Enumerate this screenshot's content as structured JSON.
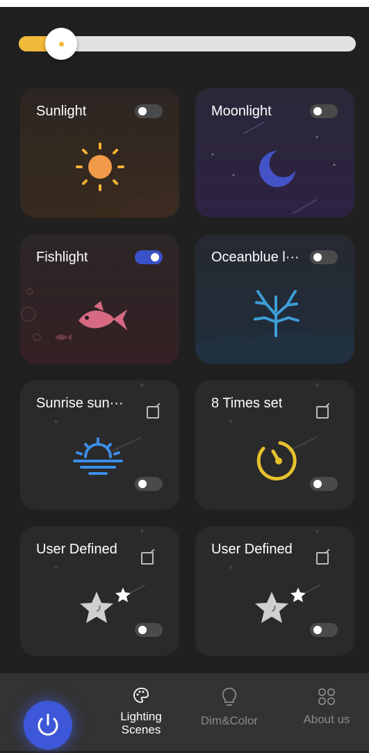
{
  "brightness": {
    "level_percent": 11
  },
  "scenes": [
    {
      "title": "Sunlight",
      "toggle_on": false
    },
    {
      "title": "Moonlight",
      "toggle_on": false
    },
    {
      "title": "Fishlight",
      "toggle_on": true
    },
    {
      "title": "Oceanblue l···",
      "toggle_on": false
    },
    {
      "title": "Sunrise sun···",
      "toggle_on": false
    },
    {
      "title": "8 Times set",
      "toggle_on": false
    },
    {
      "title": "User Defined",
      "toggle_on": false
    },
    {
      "title": "User Defined",
      "toggle_on": false
    }
  ],
  "nav": {
    "power_icon": "power-icon",
    "items": [
      {
        "label": "Lighting\nScenes",
        "icon": "palette-icon",
        "active": true
      },
      {
        "label": "Dim&Color",
        "icon": "bulb-icon",
        "active": false
      },
      {
        "label": "About us",
        "icon": "grid-icon",
        "active": false
      }
    ]
  },
  "colors": {
    "accent": "#3d57d8",
    "slider": "#f0b93a",
    "background": "#202020"
  }
}
